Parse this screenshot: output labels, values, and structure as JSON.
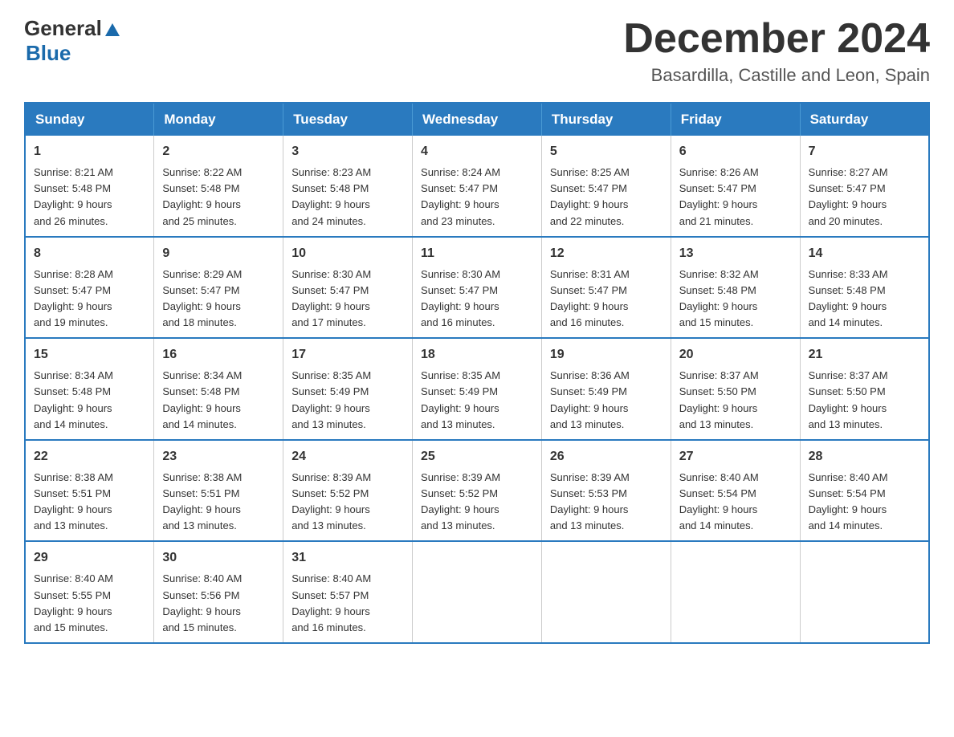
{
  "header": {
    "logo_general": "General",
    "logo_blue": "Blue",
    "month_title": "December 2024",
    "location": "Basardilla, Castille and Leon, Spain"
  },
  "days_of_week": [
    "Sunday",
    "Monday",
    "Tuesday",
    "Wednesday",
    "Thursday",
    "Friday",
    "Saturday"
  ],
  "weeks": [
    [
      {
        "day": "1",
        "sunrise": "8:21 AM",
        "sunset": "5:48 PM",
        "daylight": "9 hours and 26 minutes."
      },
      {
        "day": "2",
        "sunrise": "8:22 AM",
        "sunset": "5:48 PM",
        "daylight": "9 hours and 25 minutes."
      },
      {
        "day": "3",
        "sunrise": "8:23 AM",
        "sunset": "5:48 PM",
        "daylight": "9 hours and 24 minutes."
      },
      {
        "day": "4",
        "sunrise": "8:24 AM",
        "sunset": "5:47 PM",
        "daylight": "9 hours and 23 minutes."
      },
      {
        "day": "5",
        "sunrise": "8:25 AM",
        "sunset": "5:47 PM",
        "daylight": "9 hours and 22 minutes."
      },
      {
        "day": "6",
        "sunrise": "8:26 AM",
        "sunset": "5:47 PM",
        "daylight": "9 hours and 21 minutes."
      },
      {
        "day": "7",
        "sunrise": "8:27 AM",
        "sunset": "5:47 PM",
        "daylight": "9 hours and 20 minutes."
      }
    ],
    [
      {
        "day": "8",
        "sunrise": "8:28 AM",
        "sunset": "5:47 PM",
        "daylight": "9 hours and 19 minutes."
      },
      {
        "day": "9",
        "sunrise": "8:29 AM",
        "sunset": "5:47 PM",
        "daylight": "9 hours and 18 minutes."
      },
      {
        "day": "10",
        "sunrise": "8:30 AM",
        "sunset": "5:47 PM",
        "daylight": "9 hours and 17 minutes."
      },
      {
        "day": "11",
        "sunrise": "8:30 AM",
        "sunset": "5:47 PM",
        "daylight": "9 hours and 16 minutes."
      },
      {
        "day": "12",
        "sunrise": "8:31 AM",
        "sunset": "5:47 PM",
        "daylight": "9 hours and 16 minutes."
      },
      {
        "day": "13",
        "sunrise": "8:32 AM",
        "sunset": "5:48 PM",
        "daylight": "9 hours and 15 minutes."
      },
      {
        "day": "14",
        "sunrise": "8:33 AM",
        "sunset": "5:48 PM",
        "daylight": "9 hours and 14 minutes."
      }
    ],
    [
      {
        "day": "15",
        "sunrise": "8:34 AM",
        "sunset": "5:48 PM",
        "daylight": "9 hours and 14 minutes."
      },
      {
        "day": "16",
        "sunrise": "8:34 AM",
        "sunset": "5:48 PM",
        "daylight": "9 hours and 14 minutes."
      },
      {
        "day": "17",
        "sunrise": "8:35 AM",
        "sunset": "5:49 PM",
        "daylight": "9 hours and 13 minutes."
      },
      {
        "day": "18",
        "sunrise": "8:35 AM",
        "sunset": "5:49 PM",
        "daylight": "9 hours and 13 minutes."
      },
      {
        "day": "19",
        "sunrise": "8:36 AM",
        "sunset": "5:49 PM",
        "daylight": "9 hours and 13 minutes."
      },
      {
        "day": "20",
        "sunrise": "8:37 AM",
        "sunset": "5:50 PM",
        "daylight": "9 hours and 13 minutes."
      },
      {
        "day": "21",
        "sunrise": "8:37 AM",
        "sunset": "5:50 PM",
        "daylight": "9 hours and 13 minutes."
      }
    ],
    [
      {
        "day": "22",
        "sunrise": "8:38 AM",
        "sunset": "5:51 PM",
        "daylight": "9 hours and 13 minutes."
      },
      {
        "day": "23",
        "sunrise": "8:38 AM",
        "sunset": "5:51 PM",
        "daylight": "9 hours and 13 minutes."
      },
      {
        "day": "24",
        "sunrise": "8:39 AM",
        "sunset": "5:52 PM",
        "daylight": "9 hours and 13 minutes."
      },
      {
        "day": "25",
        "sunrise": "8:39 AM",
        "sunset": "5:52 PM",
        "daylight": "9 hours and 13 minutes."
      },
      {
        "day": "26",
        "sunrise": "8:39 AM",
        "sunset": "5:53 PM",
        "daylight": "9 hours and 13 minutes."
      },
      {
        "day": "27",
        "sunrise": "8:40 AM",
        "sunset": "5:54 PM",
        "daylight": "9 hours and 14 minutes."
      },
      {
        "day": "28",
        "sunrise": "8:40 AM",
        "sunset": "5:54 PM",
        "daylight": "9 hours and 14 minutes."
      }
    ],
    [
      {
        "day": "29",
        "sunrise": "8:40 AM",
        "sunset": "5:55 PM",
        "daylight": "9 hours and 15 minutes."
      },
      {
        "day": "30",
        "sunrise": "8:40 AM",
        "sunset": "5:56 PM",
        "daylight": "9 hours and 15 minutes."
      },
      {
        "day": "31",
        "sunrise": "8:40 AM",
        "sunset": "5:57 PM",
        "daylight": "9 hours and 16 minutes."
      },
      null,
      null,
      null,
      null
    ]
  ],
  "labels": {
    "sunrise": "Sunrise:",
    "sunset": "Sunset:",
    "daylight": "Daylight:"
  }
}
